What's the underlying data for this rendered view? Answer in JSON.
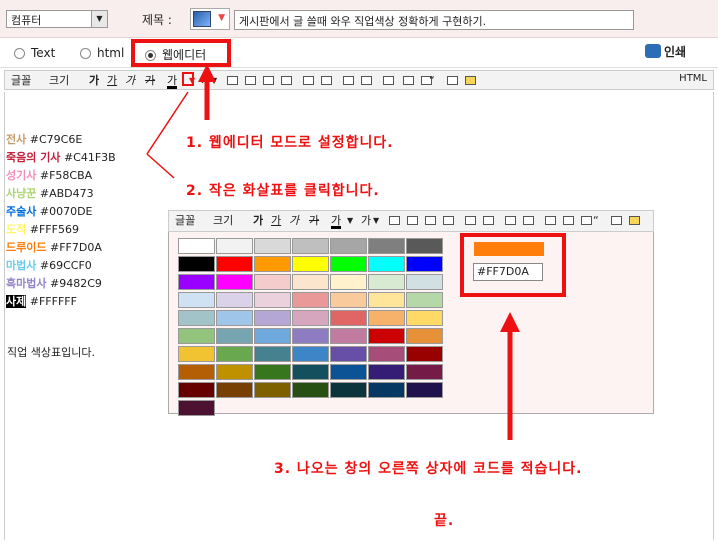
{
  "top": {
    "category_value": "컴퓨터",
    "title_label": "제목 :",
    "title_value": "게시판에서 글 쓸때 와우 직업색상 정확하게 구현하기."
  },
  "modes": {
    "text": "Text",
    "html": "html",
    "webeditor": "웹에디터",
    "print": "인쇄"
  },
  "toolbar": {
    "font": "글꼴",
    "size": "크기",
    "bold": "가",
    "underline": "가",
    "italic": "가",
    "strike": "가",
    "fontcolor": "가",
    "bgcolor": "가",
    "quote": "“",
    "html": "HTML"
  },
  "classes": [
    {
      "name": "전사",
      "code": "#C79C6E",
      "color": "#C79C6E"
    },
    {
      "name": "죽음의 기사",
      "code": "#C41F3B",
      "color": "#C41F3B"
    },
    {
      "name": "성기사",
      "code": "#F58CBA",
      "color": "#F58CBA"
    },
    {
      "name": "사냥꾼",
      "code": "#ABD473",
      "color": "#ABD473"
    },
    {
      "name": "주술사",
      "code": "#0070DE",
      "color": "#0070DE"
    },
    {
      "name": "도적",
      "code": "#FFF569",
      "color": "#FFF569"
    },
    {
      "name": "드루이드",
      "code": "#FF7D0A",
      "color": "#FF7D0A"
    },
    {
      "name": "마법사",
      "code": "#69CCF0",
      "color": "#69CCF0"
    },
    {
      "name": "흑마법사",
      "code": "#9482C9",
      "color": "#9482C9"
    },
    {
      "name": "사제",
      "code": "#FFFFFF",
      "color": "#FFFFFF"
    }
  ],
  "footer_text": "직업 색상표입니다.",
  "picker": {
    "selected_color": "#FF7D0A",
    "code_value": "#FF7D0A",
    "swatches": [
      "#ffffff",
      "#f2f2f2",
      "#d9d9d9",
      "#bfbfbf",
      "#a6a6a6",
      "#7f7f7f",
      "#595959",
      "#000000",
      "#ff0000",
      "#ff9900",
      "#ffff00",
      "#00ff00",
      "#00ffff",
      "#0000ff",
      "#9900ff",
      "#ff00ff",
      "#f4cccc",
      "#fce5cd",
      "#fff2cc",
      "#d9ead3",
      "#d0e0e3",
      "#cfe2f3",
      "#d9d2e9",
      "#ead1dc",
      "#ea9999",
      "#f9cb9c",
      "#ffe599",
      "#b6d7a8",
      "#a2c4c9",
      "#9fc5e8",
      "#b4a7d6",
      "#d5a6bd",
      "#e06666",
      "#f6b26b",
      "#ffd966",
      "#93c47d",
      "#76a5af",
      "#6fa8dc",
      "#8e7cc3",
      "#c27ba0",
      "#cc0000",
      "#e69138",
      "#f1c232",
      "#6aa84f",
      "#45818e",
      "#3d85c6",
      "#674ea7",
      "#a64d79",
      "#990000",
      "#b45f06",
      "#bf9000",
      "#38761d",
      "#134f5c",
      "#0b5394",
      "#351c75",
      "#741b47",
      "#660000",
      "#783f04",
      "#7f6000",
      "#274e13",
      "#0c343d",
      "#073763",
      "#20124d",
      "#4c1130"
    ]
  },
  "annotations": {
    "step1": "1. 웹에디터 모드로 설정합니다.",
    "step2": "2. 작은 화살표를 클릭합니다.",
    "step3": "3. 나오는 창의 오른쪽 상자에 코드를 적습니다.",
    "end": "끝."
  },
  "colors": {
    "accent_red": "#ee1111",
    "top_bg": "#f8eeee"
  }
}
